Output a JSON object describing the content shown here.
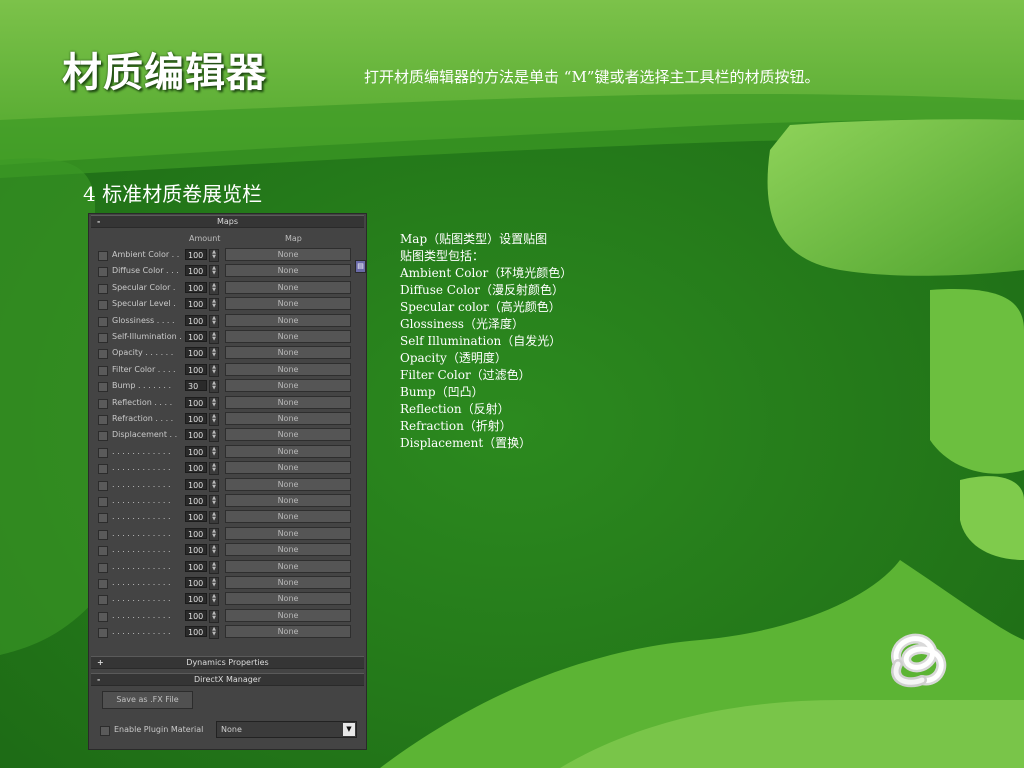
{
  "slide": {
    "title": "材质编辑器",
    "subtitle": "打开材质编辑器的方法是单击 “M”键或者选择主工具栏的材质按钮。",
    "section_heading": "4 标准材质卷展览栏"
  },
  "panel": {
    "maps_rollout": {
      "sign": "-",
      "title": "Maps"
    },
    "columns": {
      "amount": "Amount",
      "map": "Map"
    },
    "rows": [
      {
        "label": "Ambient Color . .",
        "amount": "100",
        "map": "None"
      },
      {
        "label": "Diffuse Color . . .",
        "amount": "100",
        "map": "None"
      },
      {
        "label": "Specular Color  .",
        "amount": "100",
        "map": "None"
      },
      {
        "label": "Specular Level  .",
        "amount": "100",
        "map": "None"
      },
      {
        "label": "Glossiness  . . . .",
        "amount": "100",
        "map": "None"
      },
      {
        "label": "Self-Illumination .",
        "amount": "100",
        "map": "None"
      },
      {
        "label": "Opacity . . . . . .",
        "amount": "100",
        "map": "None"
      },
      {
        "label": "Filter Color  . . . .",
        "amount": "100",
        "map": "None"
      },
      {
        "label": "Bump  . . . . . . .",
        "amount": "30",
        "map": "None"
      },
      {
        "label": "Reflection  . . . .",
        "amount": "100",
        "map": "None"
      },
      {
        "label": "Refraction  . . . .",
        "amount": "100",
        "map": "None"
      },
      {
        "label": "Displacement  . .",
        "amount": "100",
        "map": "None"
      },
      {
        "label": ". . . . . . . . . . . .",
        "amount": "100",
        "map": "None"
      },
      {
        "label": ". . . . . . . . . . . .",
        "amount": "100",
        "map": "None"
      },
      {
        "label": ". . . . . . . . . . . .",
        "amount": "100",
        "map": "None"
      },
      {
        "label": ". . . . . . . . . . . .",
        "amount": "100",
        "map": "None"
      },
      {
        "label": ". . . . . . . . . . . .",
        "amount": "100",
        "map": "None"
      },
      {
        "label": ". . . . . . . . . . . .",
        "amount": "100",
        "map": "None"
      },
      {
        "label": ". . . . . . . . . . . .",
        "amount": "100",
        "map": "None"
      },
      {
        "label": ". . . . . . . . . . . .",
        "amount": "100",
        "map": "None"
      },
      {
        "label": ". . . . . . . . . . . .",
        "amount": "100",
        "map": "None"
      },
      {
        "label": ". . . . . . . . . . . .",
        "amount": "100",
        "map": "None"
      },
      {
        "label": ". . . . . . . . . . . .",
        "amount": "100",
        "map": "None"
      },
      {
        "label": ". . . . . . . . . . . .",
        "amount": "100",
        "map": "None"
      }
    ],
    "dynamics_rollout": {
      "sign": "+",
      "title": "Dynamics Properties"
    },
    "directx_rollout": {
      "sign": "-",
      "title": "DirectX Manager"
    },
    "save_fx_button": "Save as .FX File",
    "enable_plugin_label": "Enable Plugin Material",
    "plugin_select_value": "None"
  },
  "description": {
    "lines": [
      "Map（贴图类型）设置贴图",
      "贴图类型包括：",
      "Ambient Color（环境光颜色）",
      "Diffuse Color（漫反射颜色）",
      "Specular color（高光颜色）",
      "Glossiness（光泽度）",
      "Self Illumination（自发光）",
      "Opacity（透明度）",
      "Filter Color（过滤色）",
      "Bump（凹凸）",
      "Reflection（反射）",
      "Refraction（折射）",
      "Displacement（置换）"
    ]
  },
  "colors": {
    "background_green": "#2e8b22",
    "panel_gray": "#444444",
    "text_white": "#ffffff"
  },
  "icons": {
    "logo": "knot-logo-icon"
  }
}
